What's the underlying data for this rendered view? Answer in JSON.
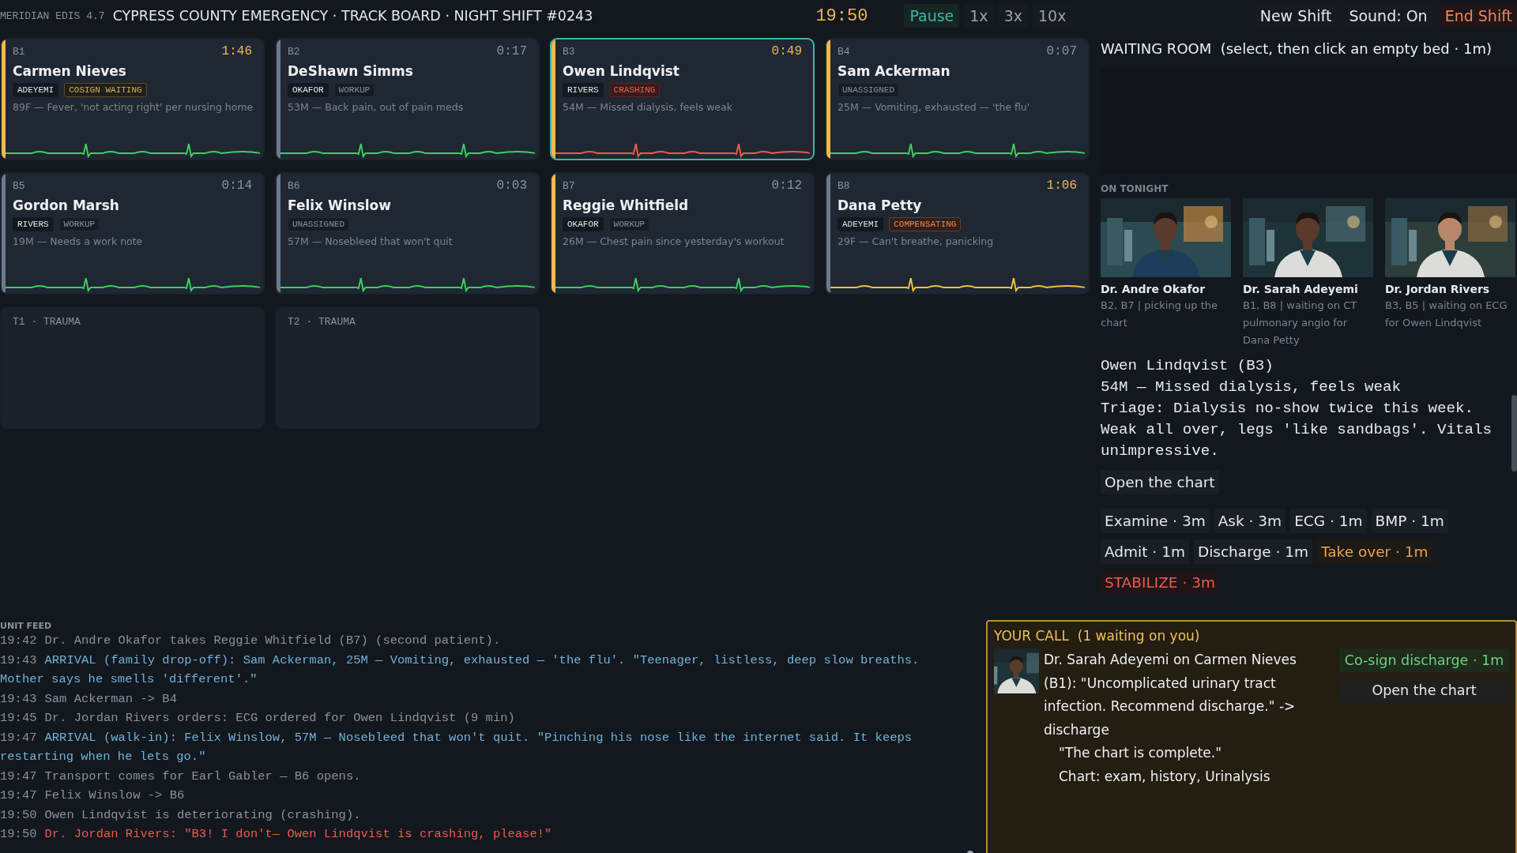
{
  "top_bar": {
    "app": "MERIDIAN EDIS 4.7",
    "title": "CYPRESS COUNTY EMERGENCY · TRACK BOARD · NIGHT SHIFT #0243",
    "clock": "19:50",
    "speed_buttons": [
      {
        "label": "Pause",
        "selected": true
      },
      {
        "label": "1x",
        "selected": false
      },
      {
        "label": "3x",
        "selected": false
      },
      {
        "label": "10x",
        "selected": false
      }
    ],
    "actions": [
      {
        "label": "New Shift",
        "kind": "normal"
      },
      {
        "label": "Sound: On",
        "kind": "normal"
      },
      {
        "label": "End Shift",
        "kind": "danger"
      }
    ]
  },
  "beds": [
    {
      "bed": "B1",
      "timer": "1:46",
      "overdue": true,
      "name": "Carmen Nieves",
      "tags": [
        {
          "label": "ADEYEMI",
          "kind": "doctor"
        },
        {
          "label": "COSIGN WAITING",
          "kind": "cosign"
        }
      ],
      "complaint": "89F — Fever, 'not acting right' per nursing home",
      "color": "#f0b94a",
      "ecg": {
        "color": "#3ecf5e"
      },
      "selected": false
    },
    {
      "bed": "B2",
      "timer": "0:17",
      "overdue": false,
      "name": "DeShawn Simms",
      "tags": [
        {
          "label": "OKAFOR",
          "kind": "doctor"
        },
        {
          "label": "WORKUP",
          "kind": "status"
        }
      ],
      "complaint": "53M — Back pain, out of pain meds",
      "color": "#6b7a8c",
      "ecg": {
        "color": "#3ecf5e"
      },
      "selected": false
    },
    {
      "bed": "B3",
      "timer": "0:49",
      "overdue": true,
      "name": "Owen Lindqvist",
      "tags": [
        {
          "label": "RIVERS",
          "kind": "doctor"
        },
        {
          "label": "CRASHING",
          "kind": "crashing"
        }
      ],
      "complaint": "54M — Missed dialysis, feels weak",
      "color": "#f0b94a",
      "ecg": {
        "color": "#ef5a4b"
      },
      "selected": true
    },
    {
      "bed": "B4",
      "timer": "0:07",
      "overdue": false,
      "name": "Sam Ackerman",
      "tags": [
        {
          "label": "UNASSIGNED",
          "kind": "status"
        }
      ],
      "complaint": "25M — Vomiting, exhausted — 'the flu'",
      "color": "#f0b94a",
      "ecg": {
        "color": "#3ecf5e"
      },
      "selected": false
    },
    {
      "bed": "B5",
      "timer": "0:14",
      "overdue": false,
      "name": "Gordon Marsh",
      "tags": [
        {
          "label": "RIVERS",
          "kind": "doctor"
        },
        {
          "label": "WORKUP",
          "kind": "status"
        }
      ],
      "complaint": "19M — Needs a work note",
      "color": "#6b7a8c",
      "ecg": {
        "color": "#3ecf5e"
      },
      "selected": false
    },
    {
      "bed": "B6",
      "timer": "0:03",
      "overdue": false,
      "name": "Felix Winslow",
      "tags": [
        {
          "label": "UNASSIGNED",
          "kind": "status"
        }
      ],
      "complaint": "57M — Nosebleed that won't quit",
      "color": "#6b7a8c",
      "ecg": {
        "color": "#3ecf5e"
      },
      "selected": false
    },
    {
      "bed": "B7",
      "timer": "0:12",
      "overdue": false,
      "name": "Reggie Whitfield",
      "tags": [
        {
          "label": "OKAFOR",
          "kind": "doctor"
        },
        {
          "label": "WORKUP",
          "kind": "status"
        }
      ],
      "complaint": "26M — Chest pain since yesterday's workout",
      "color": "#f0b94a",
      "ecg": {
        "color": "#3ecf5e"
      },
      "selected": false
    },
    {
      "bed": "B8",
      "timer": "1:06",
      "overdue": true,
      "name": "Dana Petty",
      "tags": [
        {
          "label": "ADEYEMI",
          "kind": "doctor"
        },
        {
          "label": "COMPENSATING",
          "kind": "compensating"
        }
      ],
      "complaint": "29F — Can't breathe, panicking",
      "color": "#6b7a8c",
      "ecg": {
        "color": "#ecc43a"
      },
      "selected": false
    }
  ],
  "empty_beds": [
    {
      "label": "T1 · TRAUMA"
    },
    {
      "label": "T2 · TRAUMA"
    }
  ],
  "waiting_room": {
    "heading": "WAITING ROOM  (select, then click an empty bed · 1m)"
  },
  "on_tonight": {
    "heading": "ON TONIGHT",
    "doctors": [
      {
        "name": "Dr. Andre Okafor",
        "status": "B2, B7 | picking up the chart"
      },
      {
        "name": "Dr. Sarah Adeyemi",
        "status": "B1, B8 | waiting on CT pulmonary angio for Dana Petty"
      },
      {
        "name": "Dr. Jordan Rivers",
        "status": "B3, B5 | waiting on ECG for Owen Lindqvist"
      }
    ]
  },
  "patient": {
    "title": "Owen Lindqvist (B3)",
    "summary": "54M — Missed dialysis, feels weak",
    "triage": "Triage: Dialysis no-show twice this week. Weak all over, legs 'like sandbags'. Vitals unimpressive.",
    "open_chart": "Open the chart",
    "action_rows": [
      [
        {
          "label": "Examine · 3m",
          "kind": "normal"
        },
        {
          "label": "Ask · 3m",
          "kind": "normal"
        },
        {
          "label": "ECG · 1m",
          "kind": "normal"
        },
        {
          "label": "BMP · 1m",
          "kind": "normal"
        }
      ],
      [
        {
          "label": "Admit · 1m",
          "kind": "normal"
        },
        {
          "label": "Discharge · 1m",
          "kind": "normal"
        },
        {
          "label": "Take over · 1m",
          "kind": "takeover"
        }
      ],
      [
        {
          "label": "STABILIZE · 3m",
          "kind": "critical"
        }
      ]
    ]
  },
  "feed": {
    "heading": "UNIT FEED",
    "entries": [
      {
        "time": "19:42",
        "text": "Dr. Andre Okafor takes Reggie Whitfield (B7) (second patient).",
        "kind": "normal"
      },
      {
        "time": "19:43",
        "text": "ARRIVAL (family drop-off): Sam Ackerman, 25M — Vomiting, exhausted — 'the flu'. \"Teenager, listless, deep slow breaths. Mother says he smells 'different'.\"",
        "kind": "arrival"
      },
      {
        "time": "19:43",
        "text": "Sam Ackerman -> B4",
        "kind": "normal"
      },
      {
        "time": "19:45",
        "text": "Dr. Jordan Rivers orders: ECG ordered for Owen Lindqvist (9 min)",
        "kind": "normal"
      },
      {
        "time": "19:47",
        "text": "ARRIVAL (walk-in): Felix Winslow, 57M — Nosebleed that won't quit. \"Pinching his nose like the internet said. It keeps restarting when he lets go.\"",
        "kind": "arrival"
      },
      {
        "time": "19:47",
        "text": "Transport comes for Earl Gabler — B6 opens.",
        "kind": "normal"
      },
      {
        "time": "19:47",
        "text": "Felix Winslow -> B6",
        "kind": "normal"
      },
      {
        "time": "19:50",
        "text": "Owen Lindqvist is deteriorating (crashing).",
        "kind": "normal"
      },
      {
        "time": "19:50",
        "text": "Dr. Jordan Rivers: \"B3! I don't— Owen Lindqvist is crashing, please!\"",
        "kind": "alert"
      }
    ]
  },
  "your_call": {
    "heading": "YOUR CALL  (1 waiting on you)",
    "message": "Dr. Sarah Adeyemi on Carmen Nieves (B1): \"Uncomplicated urinary tract infection. Recommend discharge.\" -> discharge",
    "quote": "\"The chart is complete.\"",
    "chart": "Chart: exam, history, Urinalysis",
    "buttons": [
      {
        "label": "Co-sign discharge · 1m",
        "kind": "confirm"
      },
      {
        "label": "Open the chart",
        "kind": "normal"
      }
    ]
  }
}
